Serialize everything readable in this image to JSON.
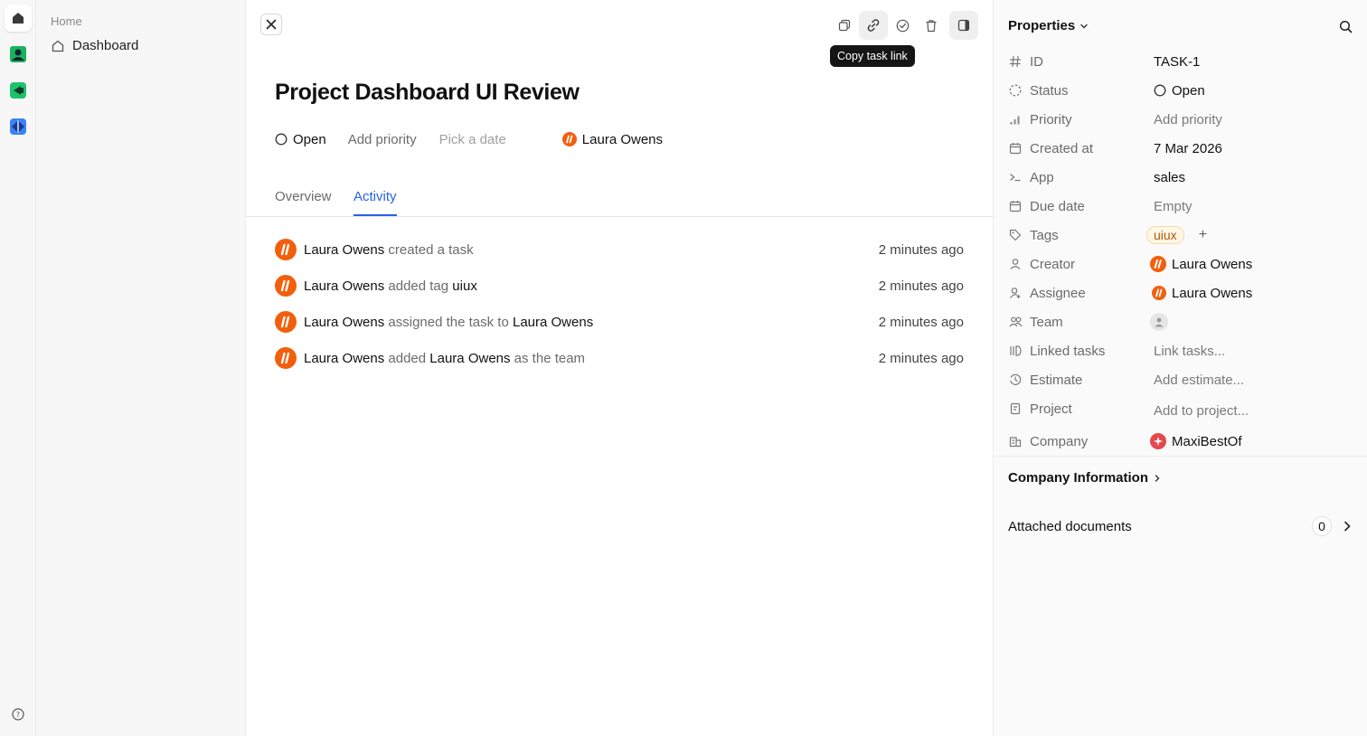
{
  "sidebar": {
    "heading": "Home",
    "items": [
      {
        "label": "Dashboard"
      }
    ]
  },
  "toolbar": {
    "tooltip": "Copy task link"
  },
  "task": {
    "title": "Project Dashboard UI Review",
    "status": "Open",
    "priority_placeholder": "Add priority",
    "date_placeholder": "Pick a date",
    "assignee": "Laura Owens"
  },
  "tabs": [
    {
      "label": "Overview"
    },
    {
      "label": "Activity",
      "active": true
    }
  ],
  "activity": [
    {
      "actor": "Laura Owens",
      "action": "created a task",
      "target": "",
      "suffix": "",
      "time": "2 minutes ago"
    },
    {
      "actor": "Laura Owens",
      "action": "added tag",
      "target": "uiux",
      "suffix": "",
      "time": "2 minutes ago"
    },
    {
      "actor": "Laura Owens",
      "action": "assigned the task to",
      "target": "Laura Owens",
      "suffix": "",
      "time": "2 minutes ago"
    },
    {
      "actor": "Laura Owens",
      "action": "added",
      "target": "Laura Owens",
      "suffix": "as the team",
      "time": "2 minutes ago"
    }
  ],
  "properties": {
    "header": "Properties",
    "id": {
      "label": "ID",
      "value": "TASK-1"
    },
    "status": {
      "label": "Status",
      "value": "Open"
    },
    "priority": {
      "label": "Priority",
      "value": "Add priority"
    },
    "created_at": {
      "label": "Created at",
      "value": "7 Mar 2026"
    },
    "app": {
      "label": "App",
      "value": "sales"
    },
    "due_date": {
      "label": "Due date",
      "value": "Empty"
    },
    "tags": {
      "label": "Tags",
      "value": "uiux",
      "add": "+"
    },
    "creator": {
      "label": "Creator",
      "value": "Laura Owens"
    },
    "assignee": {
      "label": "Assignee",
      "value": "Laura Owens"
    },
    "team": {
      "label": "Team"
    },
    "linked_tasks": {
      "label": "Linked tasks",
      "value": "Link tasks..."
    },
    "estimate": {
      "label": "Estimate",
      "value": "Add estimate..."
    },
    "project": {
      "label": "Project",
      "value": "Add to project..."
    },
    "company": {
      "label": "Company",
      "value": "MaxiBestOf"
    },
    "company_info": "Company Information",
    "attached_documents": {
      "label": "Attached documents",
      "count": "0"
    }
  },
  "colors": {
    "accent": "#2563eb",
    "avatar_orange": "#f25f0c",
    "company_red": "#e5484d"
  }
}
